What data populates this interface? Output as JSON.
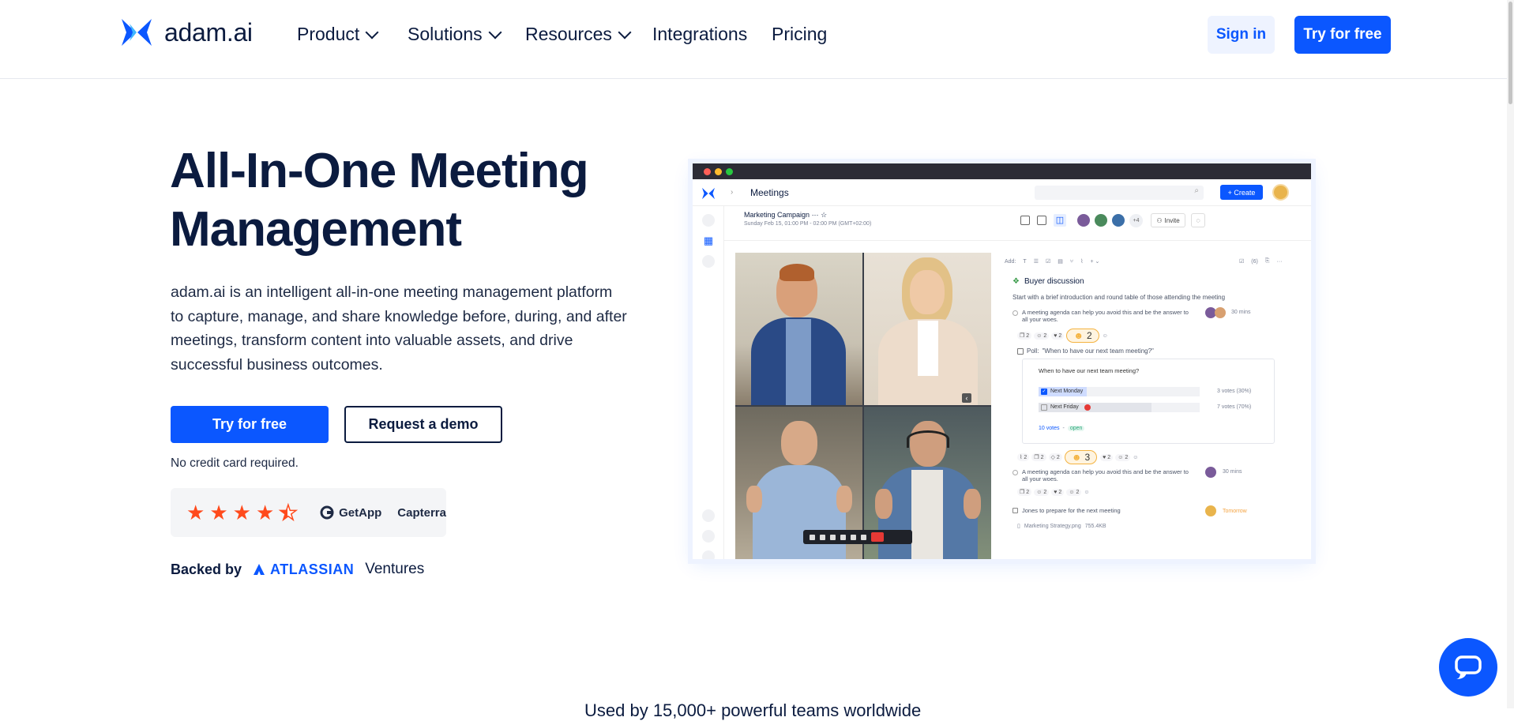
{
  "nav": {
    "logo_text": "adam.ai",
    "items": [
      {
        "label": "Product",
        "has_dropdown": true
      },
      {
        "label": "Solutions",
        "has_dropdown": true
      },
      {
        "label": "Resources",
        "has_dropdown": true
      },
      {
        "label": "Integrations",
        "has_dropdown": false
      },
      {
        "label": "Pricing",
        "has_dropdown": false
      }
    ],
    "signin_label": "Sign in",
    "tryfree_label": "Try for free"
  },
  "hero": {
    "title_line1": "All-In-One Meeting",
    "title_line2": "Management",
    "description": "adam.ai is an intelligent all-in-one meeting management platform to capture, manage, and share knowledge before, during, and after meetings, transform content into valuable assets, and drive successful business outcomes.",
    "cta_primary": "Try for free",
    "cta_secondary": "Request a demo",
    "no_credit_card": "No credit card required.",
    "rating_stars": 4.5,
    "rating_sources": [
      "GetApp",
      "Capterra"
    ],
    "backed_by_label": "Backed by",
    "backer_brand": "ATLASSIAN",
    "backer_suffix": "Ventures"
  },
  "app_preview": {
    "section_title": "Meetings",
    "create_label": "+ Create",
    "meeting_title": "Marketing Campaign",
    "meeting_time": "Sunday Feb 15, 01:00 PM - 02:00 PM (GMT+02:00)",
    "participants_more": "+4",
    "invite_label": "Invite",
    "toolbar_add_label": "Add:",
    "checklist_count": "(6)",
    "agenda_title": "Buyer discussion",
    "agenda_intro": "Start with a brief introduction and round table of those attending the meeting",
    "note1_text": "A meeting agenda can help you avoid this and be the answer to all your woes.",
    "note1_duration": "30 mins",
    "note1_reactions": [
      "2",
      "2",
      "2"
    ],
    "note1_big_reaction": "2",
    "poll_label": "Poll:",
    "poll_question_quoted": "\"When to have our next team meeting?\"",
    "poll_question": "When to have our next team meeting?",
    "poll_options": [
      {
        "label": "Next Monday",
        "votes": "3 votes (30%)",
        "percent": 30,
        "checked": true
      },
      {
        "label": "Next Friday",
        "votes": "7 votes (70%)",
        "percent": 70,
        "checked": false
      }
    ],
    "poll_total": "10 votes",
    "poll_status": "open",
    "poll_reactions": [
      "2",
      "2",
      "2"
    ],
    "poll_big_reaction": "3",
    "poll_reactions_after": [
      "2",
      "2"
    ],
    "note2_text": "A meeting agenda can help you avoid this and be the answer to all your woes.",
    "note2_duration": "30 mins",
    "note2_reactions": [
      "2",
      "2",
      "2",
      "2"
    ],
    "task_text": "Jones to prepare for the next meeting",
    "task_due": "Tomorrow",
    "attachment_name": "Marketing Strategy.png",
    "attachment_size": "755.4KB"
  },
  "bottom": {
    "partial_text": "Used by 15,000+ powerful teams worldwide"
  },
  "colors": {
    "brand_blue": "#0b57ff",
    "navy": "#0b1b3f",
    "star": "#ff4a1c"
  }
}
